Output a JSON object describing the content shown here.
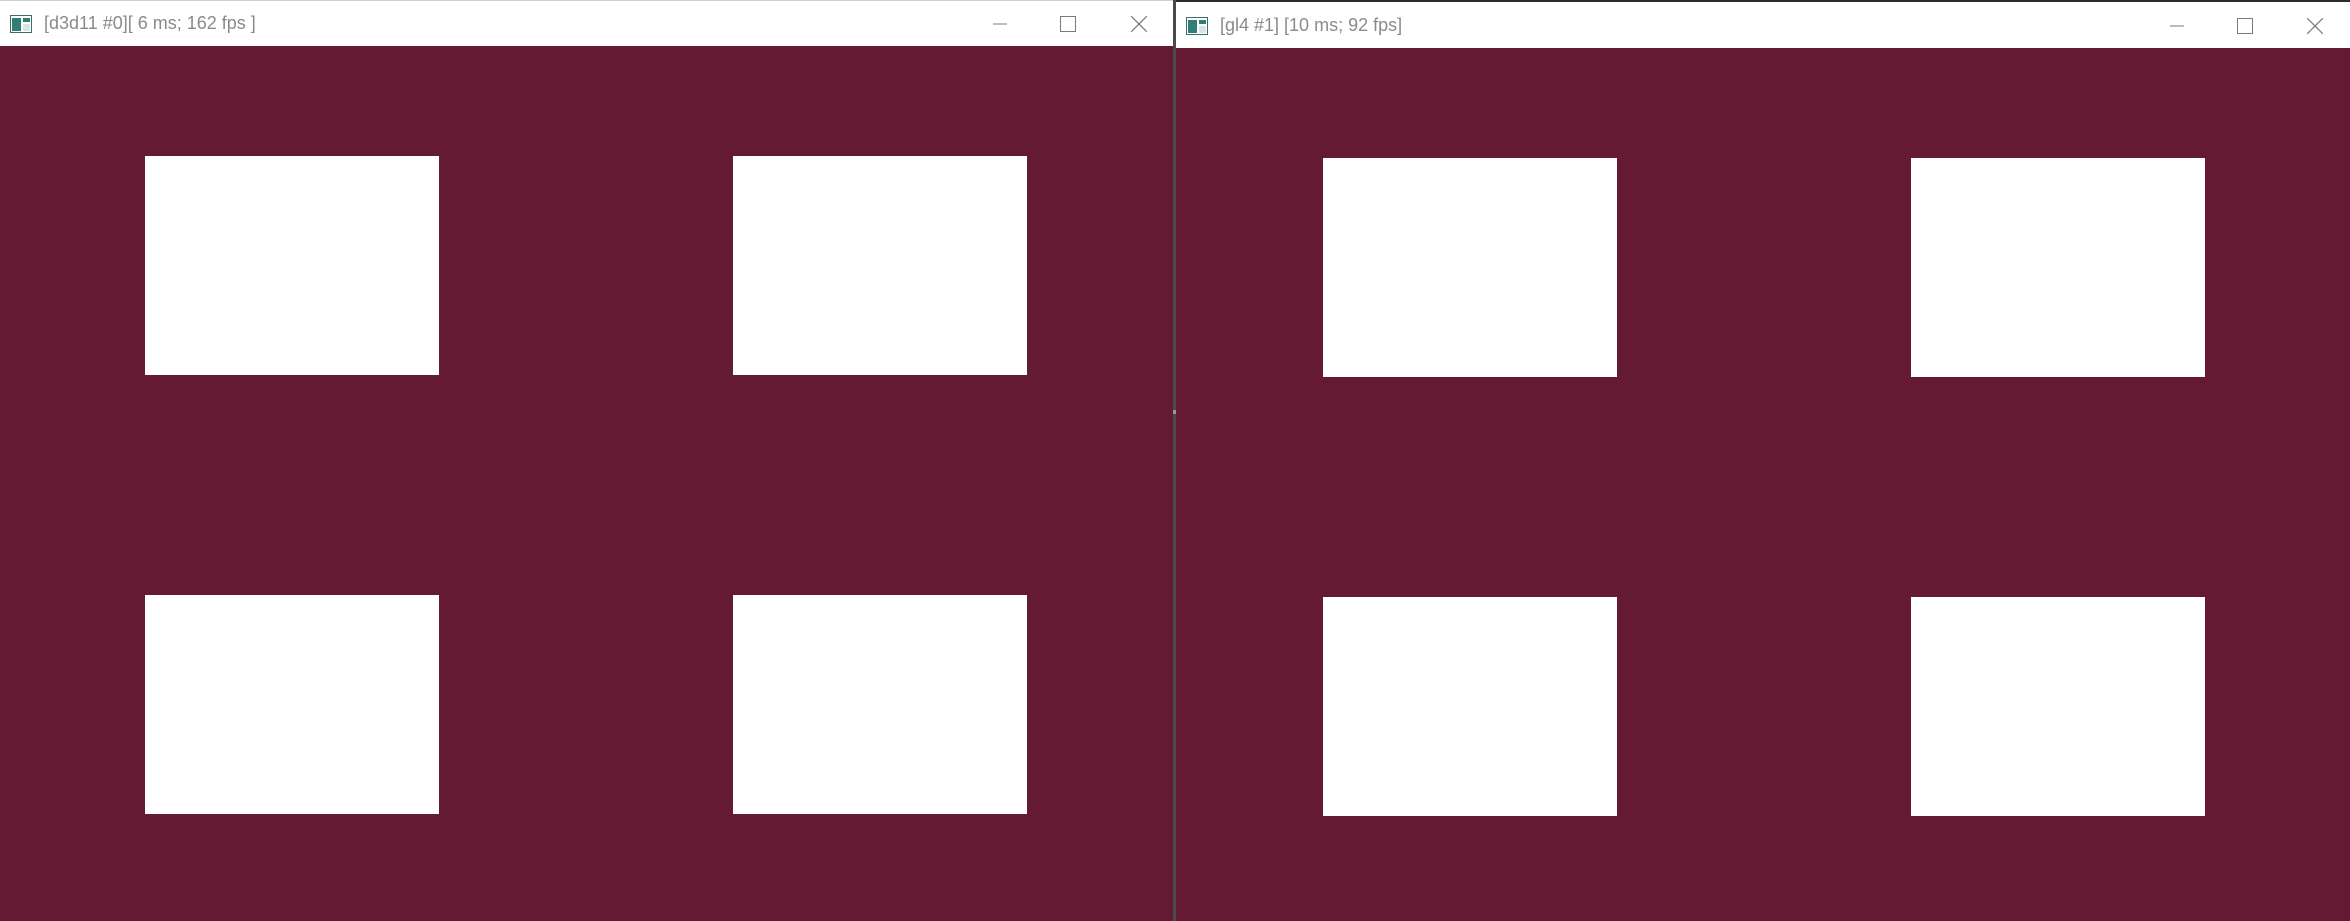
{
  "windows": [
    {
      "title": "[d3d11 #0][ 6 ms; 162 fps ]",
      "icon": "app-window-icon",
      "clear_color": "#651a33",
      "quad_color": "#ffffff"
    },
    {
      "title": "[gl4 #1] [10 ms; 92 fps]",
      "icon": "app-window-icon",
      "clear_color": "#651a33",
      "quad_color": "#ffffff"
    }
  ],
  "caption_buttons": [
    "minimize",
    "maximize",
    "close"
  ]
}
